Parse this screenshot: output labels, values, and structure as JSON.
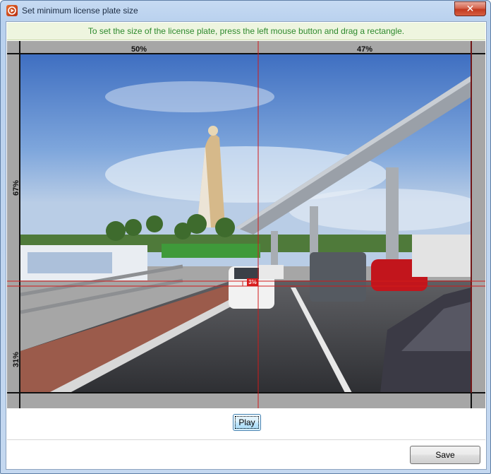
{
  "window": {
    "title": "Set minimum license plate size",
    "close_label": "✕"
  },
  "instruction": "To set the size of the license plate, press the left mouse button and drag a rectangle.",
  "measurements": {
    "top_left_pct": "50%",
    "top_right_pct": "47%",
    "left_top_pct": "67%",
    "left_bottom_pct": "31%",
    "plate_pct": "3%"
  },
  "controls": {
    "play_label": "Play",
    "save_label": "Save"
  },
  "colors": {
    "guide_line": "#d11a1a",
    "info_text": "#2d8a2d",
    "frame_gray": "#a6a6a6"
  }
}
